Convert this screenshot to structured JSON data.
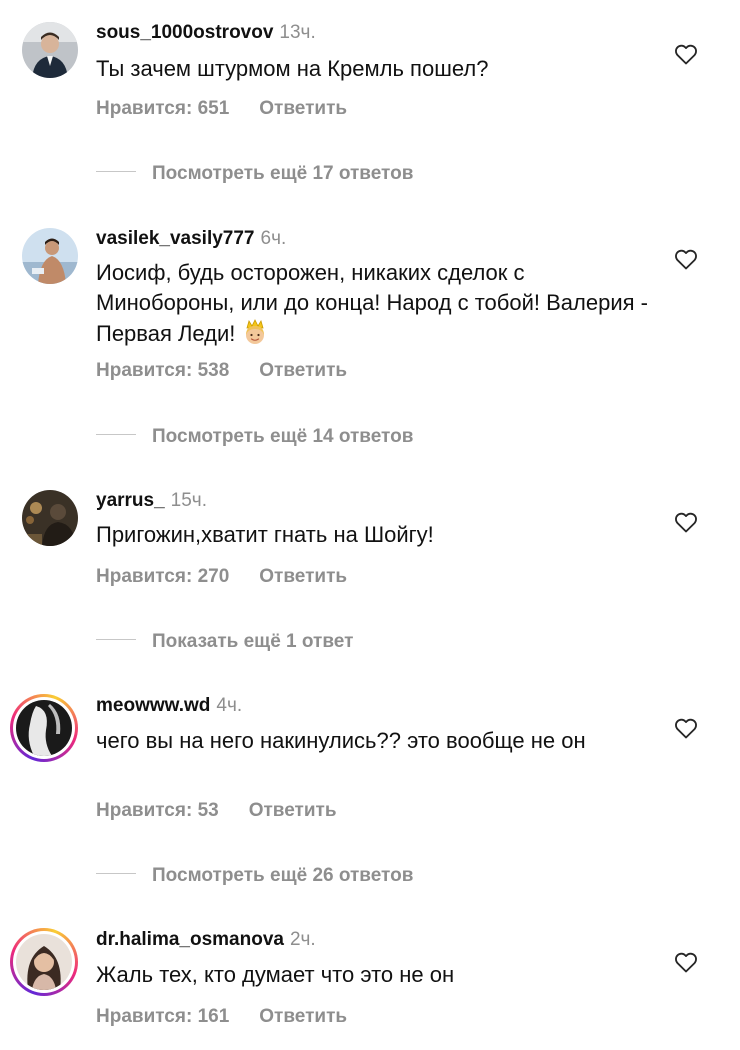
{
  "comments": [
    {
      "username": "sous_1000ostrovov",
      "time": "13ч.",
      "text": "Ты зачем штурмом на Кремль пошел?",
      "likes": "Нравится: 651",
      "reply": "Ответить",
      "more_replies": "Посмотреть ещё 17 ответов"
    },
    {
      "username": "vasilek_vasily777",
      "time": "6ч.",
      "text": "Иосиф, будь осторожен, никаких сделок с Минобороны, или до конца! Народ с тобой! Валерия - Первая Леди!",
      "emoji": "princess-emoji",
      "likes": "Нравится: 538",
      "reply": "Ответить",
      "more_replies": "Посмотреть ещё 14 ответов"
    },
    {
      "username": "yarrus_",
      "time": "15ч.",
      "text": "Пригожин,хватит гнать на Шойгу!",
      "likes": "Нравится: 270",
      "reply": "Ответить",
      "more_replies": "Показать ещё 1 ответ"
    },
    {
      "username": "meowww.wd",
      "time": "4ч.",
      "text": "чего вы на него накинулись?? это вообще не он",
      "likes": "Нравится: 53",
      "reply": "Ответить",
      "more_replies": "Посмотреть ещё 26 ответов"
    },
    {
      "username": "dr.halima_osmanova",
      "time": "2ч.",
      "text": "Жаль тех, кто думает что это не он",
      "likes": "Нравится: 161",
      "reply": "Ответить"
    }
  ],
  "colors": {
    "text": "#111111",
    "secondary": "#8e8e8e",
    "story_ring": [
      "#f9ce34",
      "#ee2a7b",
      "#6228d7"
    ]
  },
  "icons": {
    "like": "heart-outline-icon"
  }
}
